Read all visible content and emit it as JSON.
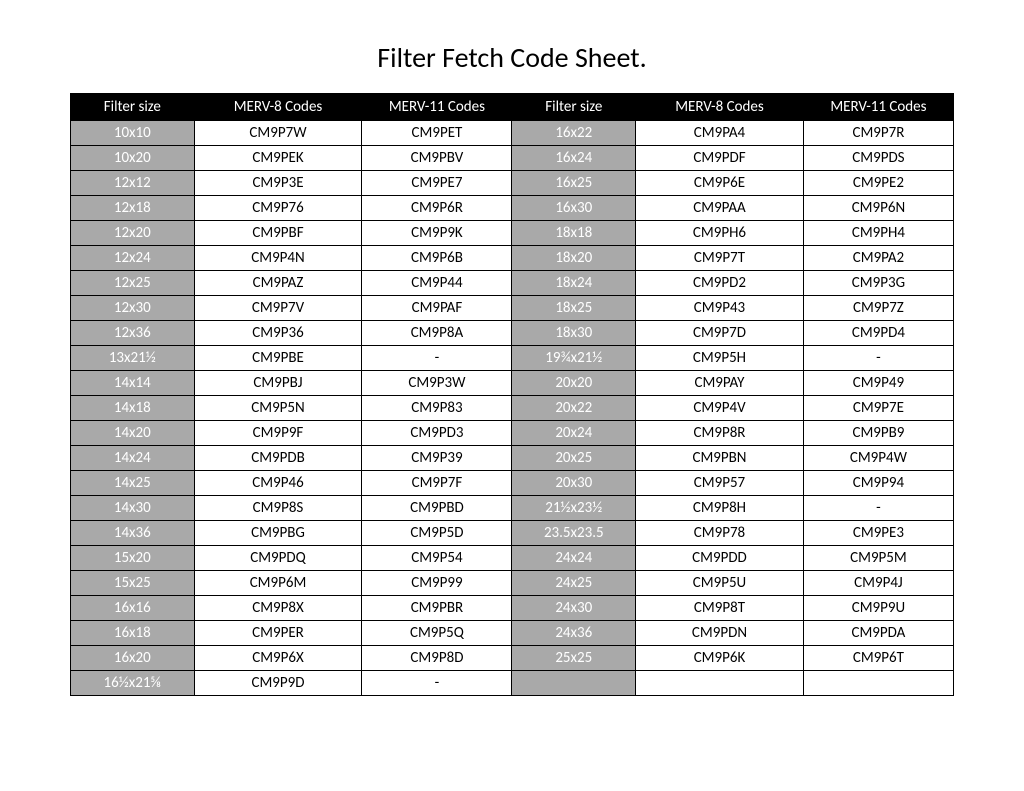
{
  "title": "Filter Fetch Code Sheet.",
  "headers": {
    "size": "Filter size",
    "merv8": "MERV-8 Codes",
    "merv11": "MERV-11 Codes"
  },
  "left": [
    {
      "size": "10x10",
      "m8": "CM9P7W",
      "m11": "CM9PET"
    },
    {
      "size": "10x20",
      "m8": "CM9PEK",
      "m11": "CM9PBV"
    },
    {
      "size": "12x12",
      "m8": "CM9P3E",
      "m11": "CM9PE7"
    },
    {
      "size": "12x18",
      "m8": "CM9P76",
      "m11": "CM9P6R"
    },
    {
      "size": "12x20",
      "m8": "CM9PBF",
      "m11": "CM9P9K"
    },
    {
      "size": "12x24",
      "m8": "CM9P4N",
      "m11": "CM9P6B"
    },
    {
      "size": "12x25",
      "m8": "CM9PAZ",
      "m11": "CM9P44"
    },
    {
      "size": "12x30",
      "m8": "CM9P7V",
      "m11": "CM9PAF"
    },
    {
      "size": "12x36",
      "m8": "CM9P36",
      "m11": "CM9P8A"
    },
    {
      "size": "13x21½",
      "m8": "CM9PBE",
      "m11": "-"
    },
    {
      "size": "14x14",
      "m8": "CM9PBJ",
      "m11": "CM9P3W"
    },
    {
      "size": "14x18",
      "m8": "CM9P5N",
      "m11": "CM9P83"
    },
    {
      "size": "14x20",
      "m8": "CM9P9F",
      "m11": "CM9PD3"
    },
    {
      "size": "14x24",
      "m8": "CM9PDB",
      "m11": "CM9P39"
    },
    {
      "size": "14x25",
      "m8": "CM9P46",
      "m11": "CM9P7F"
    },
    {
      "size": "14x30",
      "m8": "CM9P8S",
      "m11": "CM9PBD"
    },
    {
      "size": "14x36",
      "m8": "CM9PBG",
      "m11": "CM9P5D"
    },
    {
      "size": "15x20",
      "m8": "CM9PDQ",
      "m11": "CM9P54"
    },
    {
      "size": "15x25",
      "m8": "CM9P6M",
      "m11": "CM9P99"
    },
    {
      "size": "16x16",
      "m8": "CM9P8X",
      "m11": "CM9PBR"
    },
    {
      "size": "16x18",
      "m8": "CM9PER",
      "m11": "CM9P5Q"
    },
    {
      "size": "16x20",
      "m8": "CM9P6X",
      "m11": "CM9P8D"
    },
    {
      "size": "16½x21⅝",
      "m8": "CM9P9D",
      "m11": "-"
    }
  ],
  "right": [
    {
      "size": "16x22",
      "m8": "CM9PA4",
      "m11": "CM9P7R"
    },
    {
      "size": "16x24",
      "m8": "CM9PDF",
      "m11": "CM9PDS"
    },
    {
      "size": "16x25",
      "m8": "CM9P6E",
      "m11": "CM9PE2"
    },
    {
      "size": "16x30",
      "m8": "CM9PAA",
      "m11": "CM9P6N"
    },
    {
      "size": "18x18",
      "m8": "CM9PH6",
      "m11": "CM9PH4"
    },
    {
      "size": "18x20",
      "m8": "CM9P7T",
      "m11": "CM9PA2"
    },
    {
      "size": "18x24",
      "m8": "CM9PD2",
      "m11": "CM9P3G"
    },
    {
      "size": "18x25",
      "m8": "CM9P43",
      "m11": "CM9P7Z"
    },
    {
      "size": "18x30",
      "m8": "CM9P7D",
      "m11": "CM9PD4"
    },
    {
      "size": "19¾x21½",
      "m8": "CM9P5H",
      "m11": "-"
    },
    {
      "size": "20x20",
      "m8": "CM9PAY",
      "m11": "CM9P49"
    },
    {
      "size": "20x22",
      "m8": "CM9P4V",
      "m11": "CM9P7E"
    },
    {
      "size": "20x24",
      "m8": "CM9P8R",
      "m11": "CM9PB9"
    },
    {
      "size": "20x25",
      "m8": "CM9PBN",
      "m11": "CM9P4W"
    },
    {
      "size": "20x30",
      "m8": "CM9P57",
      "m11": "CM9P94"
    },
    {
      "size": "21½x23½",
      "m8": "CM9P8H",
      "m11": "-"
    },
    {
      "size": "23.5x23.5",
      "m8": "CM9P78",
      "m11": "CM9PE3"
    },
    {
      "size": "24x24",
      "m8": "CM9PDD",
      "m11": "CM9P5M"
    },
    {
      "size": "24x25",
      "m8": "CM9P5U",
      "m11": "CM9P4J"
    },
    {
      "size": "24x30",
      "m8": "CM9P8T",
      "m11": "CM9P9U"
    },
    {
      "size": "24x36",
      "m8": "CM9PDN",
      "m11": "CM9PDA"
    },
    {
      "size": "25x25",
      "m8": "CM9P6K",
      "m11": "CM9P6T"
    },
    {
      "size": "",
      "m8": "",
      "m11": ""
    }
  ]
}
